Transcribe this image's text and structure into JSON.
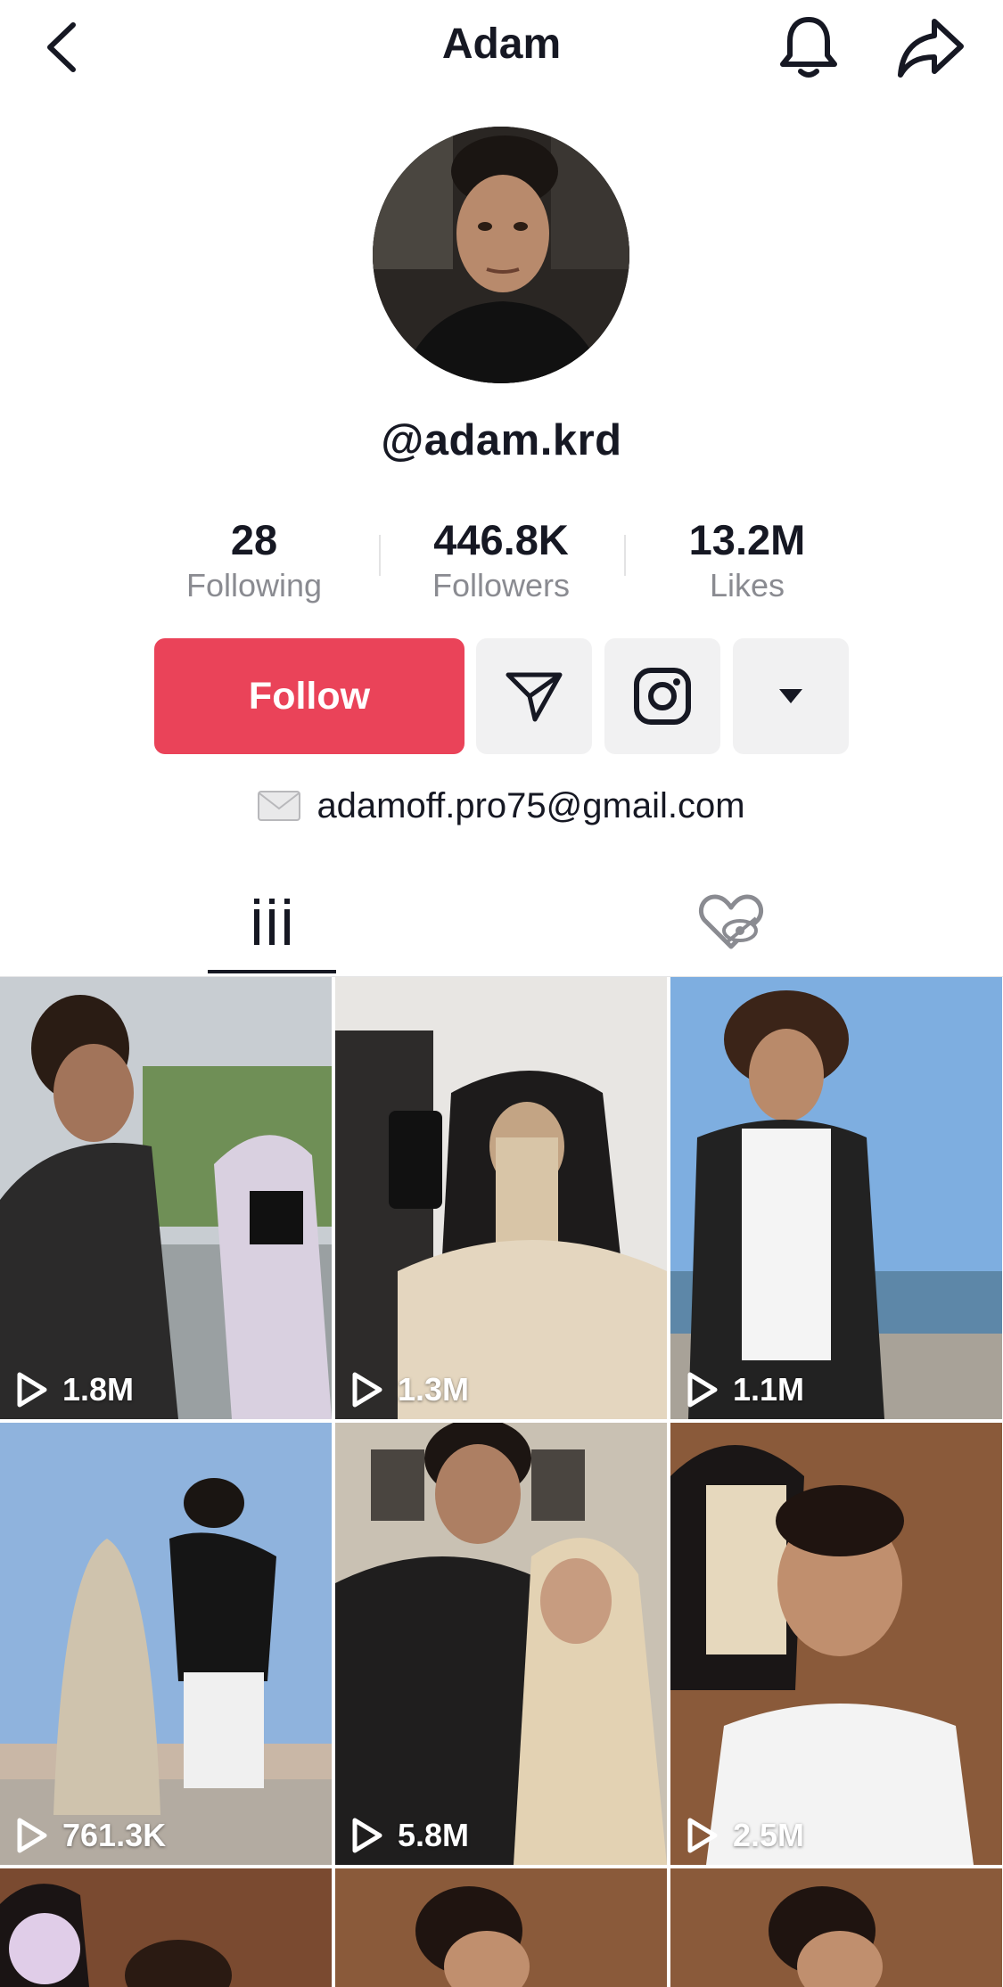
{
  "header": {
    "title": "Adam"
  },
  "profile": {
    "username": "@adam.krd",
    "stats": [
      {
        "value": "28",
        "label": "Following"
      },
      {
        "value": "446.8K",
        "label": "Followers"
      },
      {
        "value": "13.2M",
        "label": "Likes"
      }
    ],
    "follow_label": "Follow",
    "email": "adamoff.pro75@gmail.com"
  },
  "icons": {
    "back": "chevron-left-icon",
    "bell": "bell-icon",
    "share": "share-arrow-icon",
    "message": "paper-plane-icon",
    "instagram": "instagram-icon",
    "more": "caret-down-icon",
    "email": "envelope-icon",
    "videos_tab": "grid-bars-icon",
    "liked_tab": "heart-hidden-icon",
    "play": "play-outline-icon"
  },
  "colors": {
    "accent": "#ea4359",
    "text": "#161823",
    "secondary_text": "#8a8b91",
    "button_bg": "#f1f1f2"
  },
  "videos": [
    {
      "views": "1.8M"
    },
    {
      "views": "1.3M"
    },
    {
      "views": "1.1M"
    },
    {
      "views": "761.3K"
    },
    {
      "views": "5.8M"
    },
    {
      "views": "2.5M"
    },
    {
      "views": ""
    },
    {
      "views": ""
    },
    {
      "views": ""
    }
  ]
}
